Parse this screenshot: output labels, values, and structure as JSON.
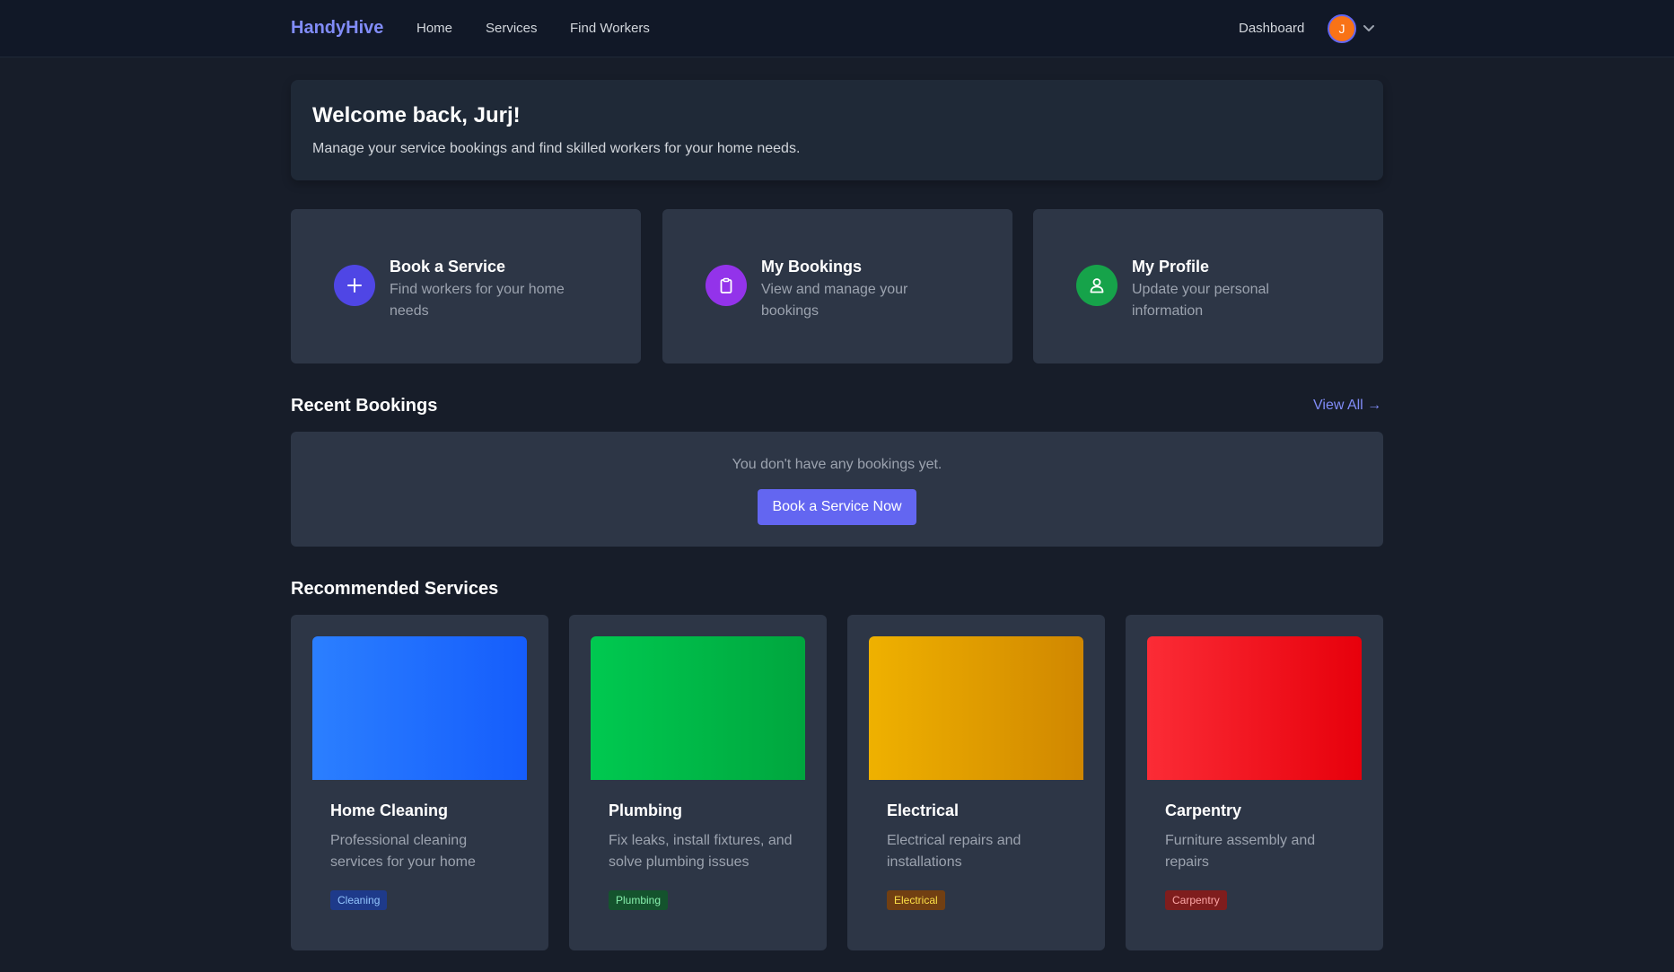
{
  "nav": {
    "brand": "HandyHive",
    "links": [
      "Home",
      "Services",
      "Find Workers"
    ],
    "dashboard": "Dashboard",
    "avatar_initial": "J"
  },
  "welcome": {
    "title": "Welcome back, Jurj!",
    "subtitle": "Manage your service bookings and find skilled workers for your home needs."
  },
  "actions": [
    {
      "title": "Book a Service",
      "desc": "Find workers for your home needs",
      "icon": "plus-icon",
      "color": "#4f46e5"
    },
    {
      "title": "My Bookings",
      "desc": "View and manage your bookings",
      "icon": "clipboard-icon",
      "color": "#9333ea"
    },
    {
      "title": "My Profile",
      "desc": "Update your personal information",
      "icon": "user-icon",
      "color": "#16a34a"
    }
  ],
  "recent": {
    "title": "Recent Bookings",
    "view_all": "View All →",
    "empty_text": "You don't have any bookings yet.",
    "cta": "Book a Service Now"
  },
  "recommended": {
    "title": "Recommended Services",
    "items": [
      {
        "name": "Home Cleaning",
        "desc": "Professional cleaning services for your home",
        "tag": "Cleaning",
        "color_from": "#2b7fff",
        "color_to": "#155dfc",
        "tag_bg": "#1e3a8a",
        "tag_fg": "#93c5fd"
      },
      {
        "name": "Plumbing",
        "desc": "Fix leaks, install fixtures, and solve plumbing issues",
        "tag": "Plumbing",
        "color_from": "#00c950",
        "color_to": "#00a63e",
        "tag_bg": "#14532d",
        "tag_fg": "#86efac"
      },
      {
        "name": "Electrical",
        "desc": "Electrical repairs and installations",
        "tag": "Electrical",
        "color_from": "#efb100",
        "color_to": "#d08700",
        "tag_bg": "#713f12",
        "tag_fg": "#fde047"
      },
      {
        "name": "Carpentry",
        "desc": "Furniture assembly and repairs",
        "tag": "Carpentry",
        "color_from": "#fb2c36",
        "color_to": "#e7000b",
        "tag_bg": "#7f1d1d",
        "tag_fg": "#fca5a5"
      }
    ]
  }
}
